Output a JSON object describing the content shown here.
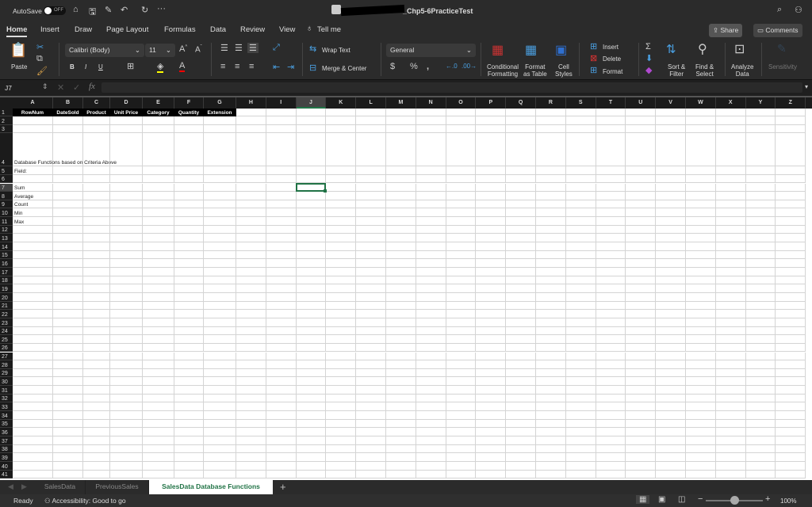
{
  "titlebar": {
    "autosave_label": "AutoSave",
    "autosave_state": "OFF",
    "doc_title": "_Chp5-6PracticeTest"
  },
  "menu_tabs": [
    "Home",
    "Insert",
    "Draw",
    "Page Layout",
    "Formulas",
    "Data",
    "Review",
    "View",
    "Tell me"
  ],
  "share_label": "Share",
  "comments_label": "Comments",
  "ribbon": {
    "paste": "Paste",
    "font_name": "Calibri (Body)",
    "font_size": "11",
    "bold": "B",
    "italic": "I",
    "underline": "U",
    "wrap_text": "Wrap Text",
    "merge_center": "Merge & Center",
    "number_format": "General",
    "currency": "$",
    "percent": "%",
    "comma": ",",
    "conditional_formatting": [
      "Conditional",
      "Formatting"
    ],
    "format_as_table": [
      "Format",
      "as Table"
    ],
    "cell_styles": [
      "Cell",
      "Styles"
    ],
    "insert": "Insert",
    "delete": "Delete",
    "format": "Format",
    "sort_filter": [
      "Sort &",
      "Filter"
    ],
    "find_select": [
      "Find &",
      "Select"
    ],
    "analyze_data": [
      "Analyze",
      "Data"
    ],
    "sensitivity": "Sensitivity"
  },
  "formula_bar": {
    "name_box": "J7",
    "formula": ""
  },
  "columns": [
    "A",
    "B",
    "C",
    "D",
    "E",
    "F",
    "G",
    "H",
    "I",
    "J",
    "K",
    "L",
    "M",
    "N",
    "O",
    "P",
    "Q",
    "R",
    "S",
    "T",
    "U",
    "V",
    "W",
    "X",
    "Y",
    "Z"
  ],
  "selected_cell": "J7",
  "header_row": [
    "RowNum",
    "DateSold",
    "Product",
    "Unit Price",
    "Category",
    "Quantity",
    "Extension"
  ],
  "cells": {
    "A4": "Database Functions based on Criteria Above",
    "A5": "Field:",
    "A7": "Sum",
    "A8": "Average",
    "A9": "Count",
    "A10": "Min",
    "A11": "Max"
  },
  "row_count": 41,
  "sheet_tabs": [
    {
      "label": "SalesData",
      "active": false
    },
    {
      "label": "PreviousSales",
      "active": false
    },
    {
      "label": "SalesData Database Functions",
      "active": true
    }
  ],
  "status": {
    "ready": "Ready",
    "accessibility": "Accessibility: Good to go",
    "zoom": "100%",
    "zoom_percent": 100
  },
  "colors": {
    "accent": "#217346",
    "background": "#2b2b2b"
  }
}
